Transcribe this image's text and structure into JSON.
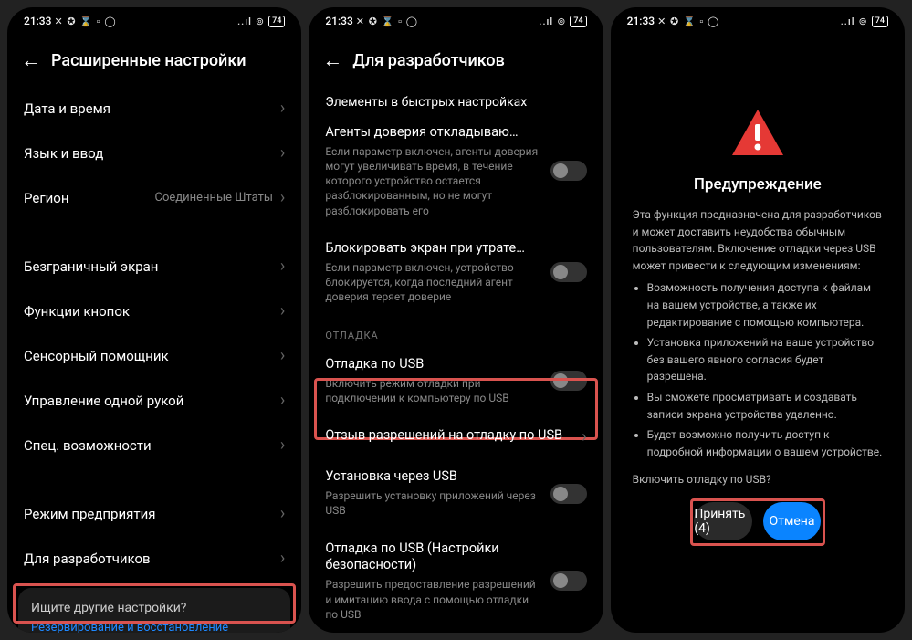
{
  "status": {
    "time": "21:33",
    "icons": "✕ ✪ ⌛ ▫ ◯",
    "signal": "..ıl",
    "wifi": "⋮",
    "battery": "74"
  },
  "s1": {
    "title": "Расширенные настройки",
    "rows": [
      {
        "label": "Дата и время"
      },
      {
        "label": "Язык и ввод"
      },
      {
        "label": "Регион",
        "value": "Соединенные Штаты"
      }
    ],
    "rows2": [
      {
        "label": "Безграничный экран"
      },
      {
        "label": "Функции кнопок"
      },
      {
        "label": "Сенсорный помощник"
      },
      {
        "label": "Управление одной рукой"
      },
      {
        "label": "Спец. возможности"
      }
    ],
    "rows3": [
      {
        "label": "Режим предприятия"
      },
      {
        "label": "Для разработчиков"
      }
    ],
    "card": {
      "q": "Ищите другие настройки?",
      "link": "Резервирование и восстановление"
    }
  },
  "s2": {
    "title": "Для разработчиков",
    "topRow": "Элементы в быстрых настройках",
    "items": [
      {
        "t": "Агенты доверия откладываю…",
        "d": "Если параметр включен, агенты доверия могут увеличивать время, в течение которого устройство остается разблокированным, но не могут разблокировать его",
        "toggle": true
      },
      {
        "t": "Блокировать экран при утрате…",
        "d": "Если параметр включен, устройство блокируется, когда последний агент доверия теряет доверие",
        "toggle": true
      }
    ],
    "section": "ОТЛАДКА",
    "debug": [
      {
        "t": "Отладка по USB",
        "d": "Включить режим отладки при подключении к компьютеру по USB",
        "toggle": true,
        "hl": true
      },
      {
        "t": "Отзыв разрешений на отладку по USB",
        "d": "",
        "toggle": false,
        "chev": true
      },
      {
        "t": "Установка через USB",
        "d": "Разрешить установку приложений через USB",
        "toggle": true
      },
      {
        "t": "Отладка по USB (Настройки безопасности)",
        "d": "Разрешить предоставление разрешений и имитацию ввода с помощью отладки по USB",
        "toggle": true
      }
    ]
  },
  "s3": {
    "title": "Предупреждение",
    "body": "Эта функция предназначена для разработчиков и может доставить неудобства обычным пользователям. Включение отладки через USB может привести к следующим изменениям:",
    "bullets": [
      "Возможность получения доступа к файлам на вашем устройстве, а также их редактирование с помощью компьютера.",
      "Установка приложений на ваше устройство без вашего явного согласия будет разрешена.",
      "Вы сможете просматривать и создавать записи экрана устройства удаленно.",
      "Будет возможно получить доступ к подробной информации о вашем устройстве."
    ],
    "footer": "Включить отладку по USB?",
    "accept": "Принять (4)",
    "cancel": "Отмена"
  }
}
